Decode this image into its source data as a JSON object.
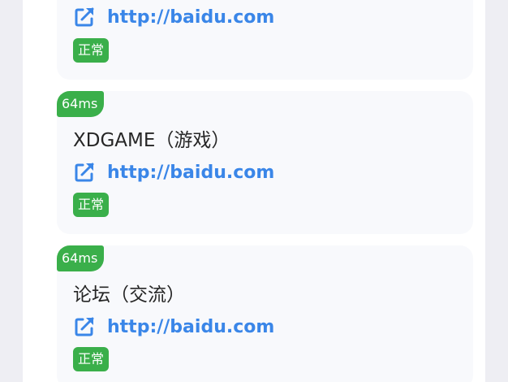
{
  "sites": [
    {
      "url": "http://baidu.com",
      "status": "正常"
    },
    {
      "latency": "64ms",
      "title": "XDGAME（游戏）",
      "url": "http://baidu.com",
      "status": "正常"
    },
    {
      "latency": "64ms",
      "title": "论坛（交流）",
      "url": "http://baidu.com",
      "status": "正常"
    }
  ],
  "colors": {
    "accent_green": "#3aaf4a",
    "link_blue": "#3a86e8",
    "card_bg": "#f8f9fc",
    "page_bg": "#eeeef3"
  },
  "icons": {
    "link": "external-link-icon"
  }
}
